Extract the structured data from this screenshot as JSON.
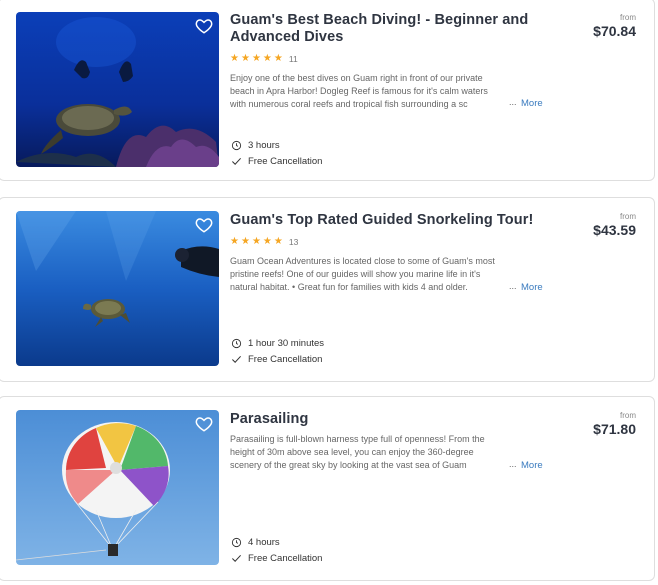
{
  "listings": [
    {
      "title": "Guam's Best Beach Diving! - Beginner and Advanced Dives",
      "title_line1": "Guam's Best Beach Diving! - Beginner and",
      "title_line2": "Advanced Dives",
      "rating_count": "11",
      "desc_lines": [
        "Enjoy one of the best dives on Guam right in front of our private",
        "beach in Apra Harbor! Dogleg Reef is famous for it's calm waters",
        "with  numerous coral reefs and tropical fish surrounding a sc"
      ],
      "ellipsis": "...",
      "more_label": "More",
      "duration": "3 hours",
      "cancellation": "Free Cancellation",
      "from_label": "from",
      "price": "$70.84",
      "icons": [
        "heart-icon",
        "clock-icon",
        "check-icon",
        "star-icon"
      ]
    },
    {
      "title": "Guam's Top Rated Guided Snorkeling Tour!",
      "rating_count": "13",
      "desc_lines": [
        "Guam Ocean Adventures is located close to some of Guam's most",
        "pristine reefs! One of our guides will show you marine life in it's",
        "natural habitat. • Great fun for families with kids 4 and older."
      ],
      "ellipsis": "...",
      "more_label": "More",
      "duration": "1 hour 30 minutes",
      "cancellation": "Free Cancellation",
      "from_label": "from",
      "price": "$43.59"
    },
    {
      "title": "Parasailing",
      "desc_lines": [
        "Parasailing is full-blown harness type full of openness! From the",
        "height of 30m above sea level, you can enjoy the 360-degree",
        "scenery of the great sky by looking at the vast sea of Guam"
      ],
      "ellipsis": "...",
      "more_label": "More",
      "duration": "4 hours",
      "cancellation": "Free Cancellation",
      "from_label": "from",
      "price": "$71.80"
    }
  ],
  "colors": {
    "star": "#f5a623",
    "link": "#3a7bbf",
    "title": "#2f3541"
  }
}
